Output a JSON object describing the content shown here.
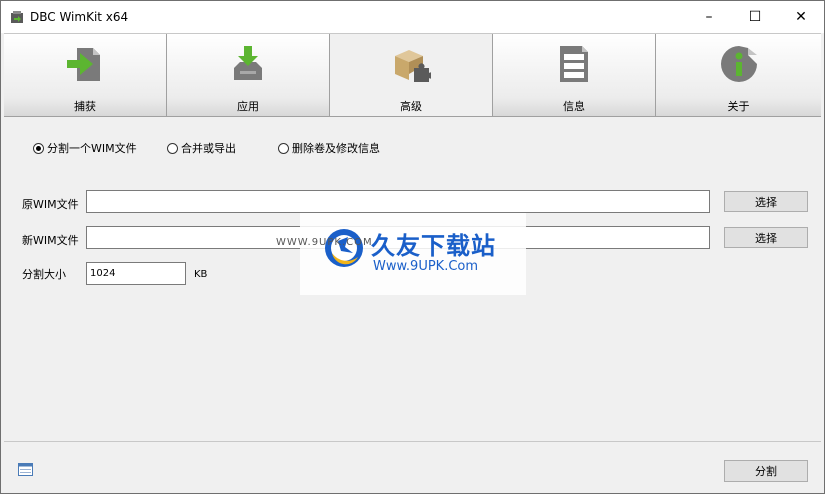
{
  "window": {
    "title": "DBC WimKit x64",
    "minimize": "–",
    "maximize": "☐",
    "close": "✕"
  },
  "tabs": [
    {
      "label": "捕获",
      "icon": "arrow-into-page-icon",
      "active": false
    },
    {
      "label": "应用",
      "icon": "download-tray-icon",
      "active": false
    },
    {
      "label": "高级",
      "icon": "box-puzzle-icon",
      "active": true
    },
    {
      "label": "信息",
      "icon": "document-list-icon",
      "active": false
    },
    {
      "label": "关于",
      "icon": "info-circle-icon",
      "active": false
    }
  ],
  "modes": [
    {
      "label": "分割一个WIM文件",
      "checked": true
    },
    {
      "label": "合并或导出",
      "checked": false
    },
    {
      "label": "删除卷及修改信息",
      "checked": false
    }
  ],
  "source": {
    "label": "原WIM文件",
    "value": "",
    "button": "选择"
  },
  "target": {
    "label": "新WIM文件",
    "value": "",
    "button": "选择"
  },
  "split_size": {
    "label": "分割大小",
    "value": "1024",
    "unit": "KB"
  },
  "action_button": "分割",
  "watermark": {
    "title": "久友下载站",
    "url": "Www.9UPK.Com",
    "small": "WWW.9UPK.COM"
  },
  "colors": {
    "accent_green": "#5cb531",
    "watermark_blue": "#1a5fc9",
    "icon_gray": "#7a7a7a"
  }
}
